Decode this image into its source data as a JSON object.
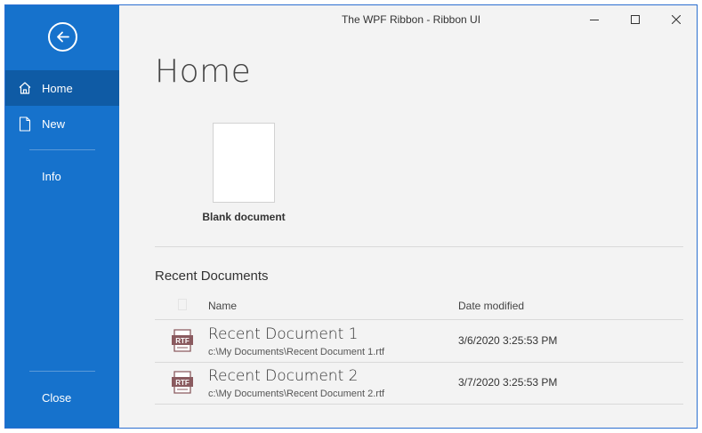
{
  "window": {
    "title": "The WPF Ribbon - Ribbon UI"
  },
  "sidebar": {
    "back_icon": "arrow-left-circle-icon",
    "items": [
      {
        "label": "Home",
        "icon": "home-icon",
        "active": true
      },
      {
        "label": "New",
        "icon": "document-icon",
        "active": false
      },
      {
        "label": "Info",
        "icon": "",
        "active": false
      }
    ],
    "close_label": "Close"
  },
  "main": {
    "title": "Home",
    "blank_document_label": "Blank document",
    "recent": {
      "title": "Recent Documents",
      "columns": {
        "name": "Name",
        "date": "Date modified"
      },
      "items": [
        {
          "name": "Recent Document 1",
          "path": "c:\\My Documents\\Recent Document 1.rtf",
          "date": "3/6/2020 3:25:53 PM",
          "type": "RTF"
        },
        {
          "name": "Recent Document 2",
          "path": "c:\\My Documents\\Recent Document 2.rtf",
          "date": "3/7/2020 3:25:53 PM",
          "type": "RTF"
        }
      ]
    }
  },
  "colors": {
    "sidebar": "#1672cc",
    "sidebar_active": "#0f5ba5",
    "content_bg": "#f3f3f3",
    "rtf_icon": "#8a5a5f"
  }
}
